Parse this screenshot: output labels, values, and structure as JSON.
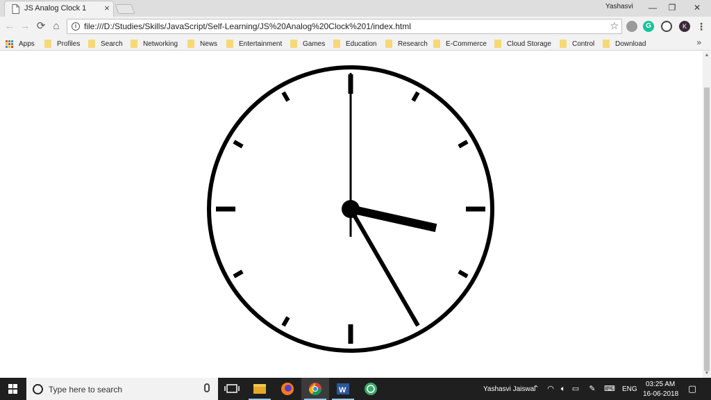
{
  "browser": {
    "tab": {
      "title": "JS Analog Clock 1",
      "close": "×"
    },
    "user": "Yashasvi",
    "window_controls": {
      "minimize": "—",
      "restore": "❐",
      "close": "✕"
    },
    "nav": {
      "back": "←",
      "forward": "→",
      "reload": "⟳",
      "home": "⌂"
    },
    "address": {
      "url": "file:///D:/Studies/Skills/JavaScript/Self-Learning/JS%20Analog%20Clock%201/index.html",
      "info": "i",
      "star": "☆"
    },
    "bookmarks": {
      "apps": "Apps",
      "items": [
        "Profiles",
        "Search",
        "Networking",
        "News",
        "Entertainment",
        "Games",
        "Education",
        "Research",
        "E-Commerce",
        "Cloud Storage",
        "Control",
        "Download"
      ],
      "more": "»"
    },
    "extensions": {
      "grammarly": "G",
      "profile": "K"
    }
  },
  "clock": {
    "hours": 3,
    "minutes": 25,
    "seconds": 0,
    "face_color": "#000000",
    "background": "#ffffff"
  },
  "taskbar": {
    "search_placeholder": "Type here to search",
    "user": "Yashasvi Jaiswal",
    "language": "ENG",
    "time": "03:25 AM",
    "date": "16-06-2018"
  },
  "colors": {
    "accent": "#9bc5ea",
    "folder": "#f6d977"
  }
}
